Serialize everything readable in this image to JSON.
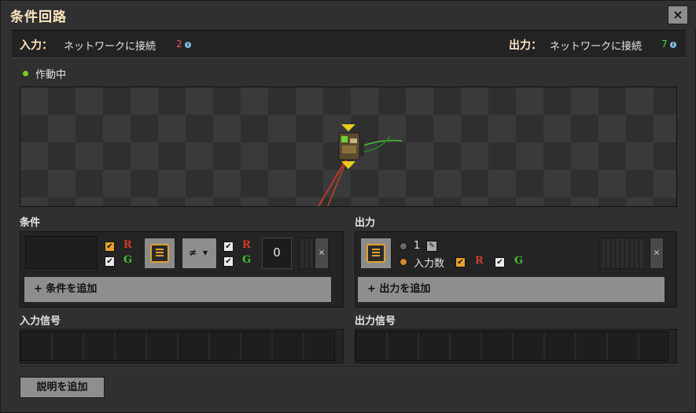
{
  "window": {
    "title": "条件回路",
    "close_glyph": "×"
  },
  "connection": {
    "input_label": "入力：",
    "input_text": "ネットワークに接続",
    "input_count": "2",
    "input_count_color": "#e06060",
    "output_label": "出力：",
    "output_text": "ネットワークに接続",
    "output_count": "7",
    "output_count_color": "#4fcf4f",
    "info_glyph": "i"
  },
  "status": {
    "text": "作動中",
    "color": "#7ccd1a"
  },
  "conditions": {
    "label": "条件",
    "red_wire_glyph": "R",
    "green_wire_glyph": "G",
    "check_glyph": "✔",
    "comparator": "≠",
    "comparator_caret": "▾",
    "constant": "0",
    "remove_glyph": "×",
    "add_label": "+ 条件を追加"
  },
  "outputs": {
    "label": "出力",
    "option_constant": "1",
    "option_input_count": "入力数",
    "edit_glyph": "✎",
    "remove_glyph": "×",
    "add_label": "+ 出力を追加"
  },
  "input_signals": {
    "label": "入力信号"
  },
  "output_signals": {
    "label": "出力信号"
  },
  "description_button": "説明を追加",
  "colors": {
    "accent_orange": "#e3a12c",
    "title_color": "#ffe6c0",
    "red_wire": "#d03a2d",
    "green_wire": "#3fc230"
  }
}
